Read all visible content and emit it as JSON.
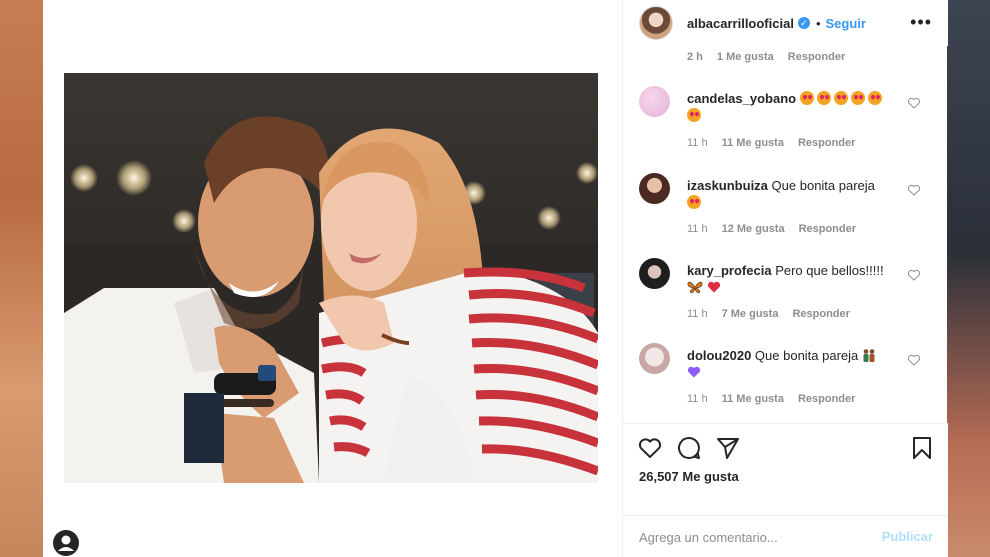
{
  "post": {
    "username": "albacarrillooficial",
    "dot": "•",
    "follow_label": "Seguir",
    "more_label": "•••"
  },
  "cut_comment_meta": {
    "time": "2 h",
    "likes": "1 Me gusta",
    "reply": "Responder"
  },
  "comments": [
    {
      "user": "candelas_yobano",
      "text": "",
      "emojis": [
        "heart-eyes",
        "heart-eyes",
        "heart-eyes",
        "heart-eyes",
        "heart-eyes",
        "heart-eyes"
      ],
      "time": "11 h",
      "likes": "11 Me gusta",
      "reply": "Responder"
    },
    {
      "user": "izaskunbuiza",
      "text": "Que bonita pareja",
      "emojis": [
        "heart-eyes"
      ],
      "time": "11 h",
      "likes": "12 Me gusta",
      "reply": "Responder"
    },
    {
      "user": "kary_profecia",
      "text": "Pero que bellos!!!!!",
      "emojis": [
        "butterfly",
        "red-heart"
      ],
      "time": "11 h",
      "likes": "7 Me gusta",
      "reply": "Responder"
    },
    {
      "user": "dolou2020",
      "text": "Que bonita pareja",
      "emojis": [
        "couple",
        "purple-heart"
      ],
      "time": "11 h",
      "likes": "11 Me gusta",
      "reply": "Responder"
    }
  ],
  "likes_count": "26,507 Me gusta",
  "comment_box": {
    "placeholder": "Agrega un comentario...",
    "publish_label": "Publicar"
  },
  "colors": {
    "accent": "#3897f0",
    "publish_disabled": "#b2dffc",
    "muted": "#8e8e8e"
  }
}
